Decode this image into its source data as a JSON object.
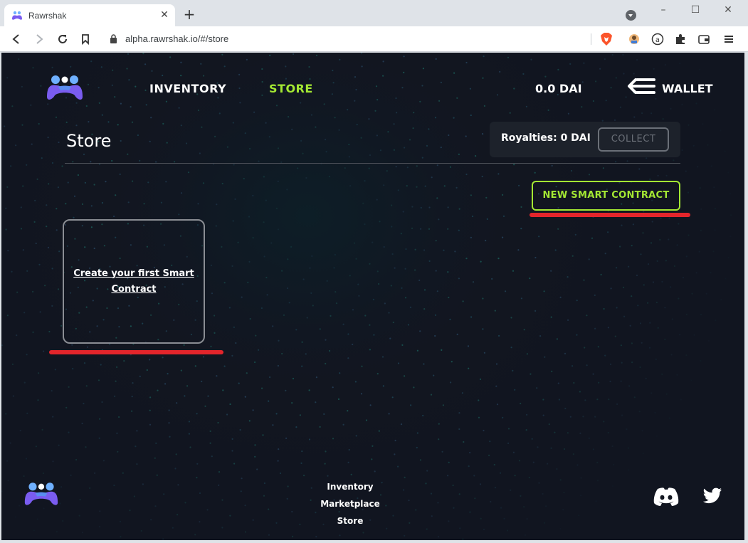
{
  "browser": {
    "tab_title": "Rawrshak",
    "new_tab": "+",
    "url": "alpha.rawrshak.io/#/store"
  },
  "header": {
    "nav": [
      "INVENTORY",
      "STORE"
    ],
    "balance": "0.0 DAI",
    "wallet_label": "WALLET"
  },
  "store": {
    "title": "Store",
    "royalties": "Royalties: 0 DAI",
    "collect_label": "COLLECT",
    "new_contract_label": "NEW SMART CONTRACT",
    "create_text": "Create your first Smart Contract"
  },
  "footer": {
    "links": [
      "Inventory",
      "Marketplace",
      "Store"
    ]
  },
  "colors": {
    "accent": "#a4e833",
    "background": "#121620",
    "annotation": "#e3252b",
    "logo_purple": "#7a5cf0",
    "logo_blue": "#6fb0ff"
  },
  "icons": [
    "rawrshak-logo-icon",
    "back-icon",
    "forward-icon",
    "reload-icon",
    "bookmark-icon",
    "lock-icon",
    "brave-shield-icon",
    "extension-icon",
    "wallet-icon",
    "menu-icon",
    "arrow-left-icon",
    "discord-icon",
    "twitter-icon"
  ]
}
